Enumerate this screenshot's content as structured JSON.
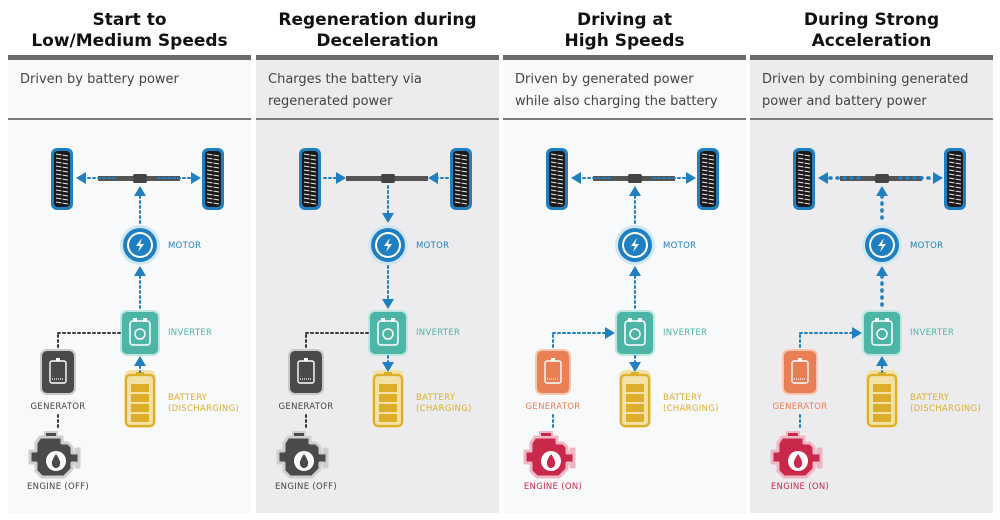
{
  "colors": {
    "blue": "#1f7fc1",
    "teal": "#4cb5a6",
    "battery": "#dcae2a",
    "grey_off": "#4a4a4a",
    "generator_on": "#ea7e55",
    "engine_on": "#c8294a",
    "title_bar": "#6a6a6a"
  },
  "panels": [
    {
      "title": [
        "Start to",
        "Low/Medium Speeds"
      ],
      "description": [
        "Driven by battery power"
      ],
      "background": "light",
      "labels": {
        "motor": "MOTOR",
        "inverter": "INVERTER",
        "battery": [
          "BATTERY",
          "(DISCHARGING)"
        ],
        "generator": "GENERATOR",
        "engine": "ENGINE (OFF)"
      },
      "state": {
        "engine_on": false,
        "wheel_flow": "out",
        "motor_flow": "up",
        "battery_flow": "up",
        "generator_flow": "none",
        "inverter_motor_flow": "up"
      }
    },
    {
      "title": [
        "Regeneration during",
        "Deceleration"
      ],
      "description": [
        "Charges the battery via",
        "regenerated power"
      ],
      "background": "grey",
      "labels": {
        "motor": "MOTOR",
        "inverter": "INVERTER",
        "battery": [
          "BATTERY",
          "(CHARGING)"
        ],
        "generator": "GENERATOR",
        "engine": "ENGINE (OFF)"
      },
      "state": {
        "engine_on": false,
        "wheel_flow": "in",
        "motor_flow": "down",
        "battery_flow": "down",
        "generator_flow": "none",
        "inverter_motor_flow": "down"
      }
    },
    {
      "title": [
        "Driving at",
        "High Speeds"
      ],
      "description": [
        "Driven by generated power",
        "while also charging the battery"
      ],
      "background": "light",
      "labels": {
        "motor": "MOTOR",
        "inverter": "INVERTER",
        "battery": [
          "BATTERY",
          "(CHARGING)"
        ],
        "generator": "GENERATOR",
        "engine": "ENGINE (ON)"
      },
      "state": {
        "engine_on": true,
        "wheel_flow": "out",
        "motor_flow": "up",
        "battery_flow": "down",
        "generator_flow": "to-inverter",
        "inverter_motor_flow": "up"
      }
    },
    {
      "title": [
        "During Strong",
        "Acceleration"
      ],
      "description": [
        "Driven by combining generated",
        "power and battery power"
      ],
      "background": "grey",
      "labels": {
        "motor": "MOTOR",
        "inverter": "INVERTER",
        "battery": [
          "BATTERY",
          "(DISCHARGING)"
        ],
        "generator": "GENERATOR",
        "engine": "ENGINE (ON)"
      },
      "state": {
        "engine_on": true,
        "wheel_flow": "out-strong",
        "motor_flow": "up-strong",
        "battery_flow": "up",
        "generator_flow": "to-inverter",
        "inverter_motor_flow": "up-strong"
      }
    }
  ]
}
